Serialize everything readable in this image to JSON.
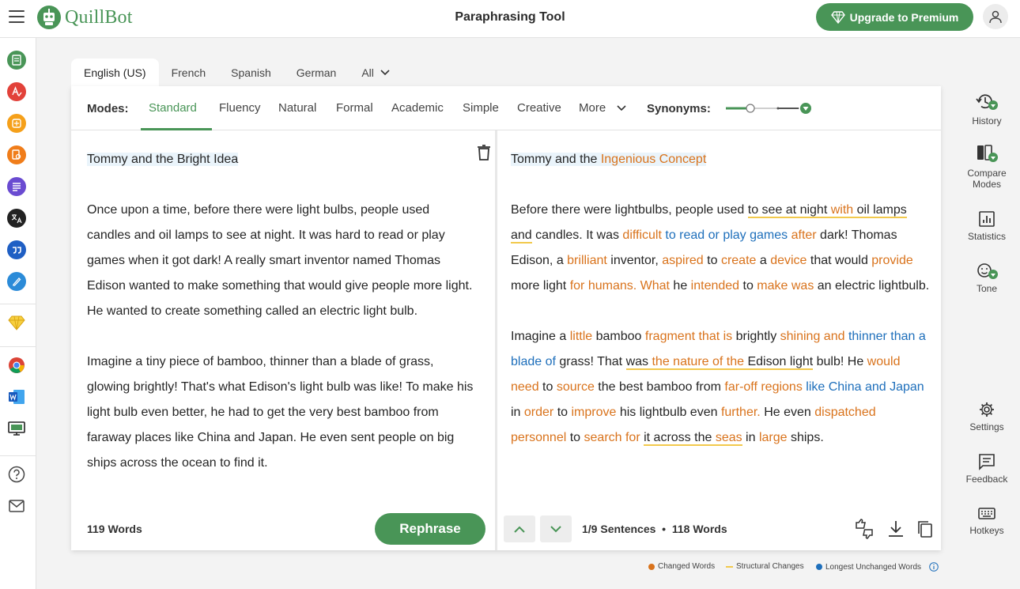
{
  "app": {
    "name": "QuillBot",
    "title": "Paraphrasing Tool"
  },
  "header": {
    "upgrade_label": "Upgrade to Premium"
  },
  "languages": [
    "English (US)",
    "French",
    "Spanish",
    "German",
    "All"
  ],
  "modes": {
    "label": "Modes:",
    "items": [
      "Standard",
      "Fluency",
      "Natural",
      "Formal",
      "Academic",
      "Simple",
      "Creative",
      "More"
    ],
    "active": "Standard",
    "synonyms_label": "Synonyms:",
    "synonyms_level": 0.3
  },
  "input": {
    "title": "Tommy and the Bright Idea",
    "paragraphs": [
      "Once upon a time, before there were light bulbs, people used candles and oil lamps to see at night.  It was hard to read or play games when it got dark! A really smart inventor named Thomas Edison wanted to make something that would give people more light. He wanted to create something called an electric light bulb.",
      "Imagine a tiny piece of bamboo, thinner than a blade of grass, glowing brightly! That's what Edison's light bulb was like!  To make his light bulb even better, he had to get the very best bamboo from faraway places like China and Japan. He even sent people on big ships across the ocean to find it."
    ],
    "word_count": "119 Words",
    "rephrase_label": "Rephrase"
  },
  "output": {
    "title_segments": [
      {
        "t": "Tommy and the ",
        "k": "n"
      },
      {
        "t": "Ingenious Concept",
        "k": "c"
      }
    ],
    "paragraphs": [
      [
        {
          "t": "Before there were lightbulbs, people used ",
          "k": "n"
        },
        {
          "t": "to see at night ",
          "k": "y"
        },
        {
          "t": "with",
          "k": "cy"
        },
        {
          "t": " oil lamps and",
          "k": "y"
        },
        {
          "t": " candles.  It was ",
          "k": "n"
        },
        {
          "t": "difficult",
          "k": "c"
        },
        {
          "t": " ",
          "k": "n"
        },
        {
          "t": "to read or play games",
          "k": "b"
        },
        {
          "t": " ",
          "k": "n"
        },
        {
          "t": "after",
          "k": "c"
        },
        {
          "t": " dark! Thomas Edison, a ",
          "k": "n"
        },
        {
          "t": "brilliant",
          "k": "c"
        },
        {
          "t": " inventor, ",
          "k": "n"
        },
        {
          "t": "aspired",
          "k": "c"
        },
        {
          "t": " to ",
          "k": "n"
        },
        {
          "t": "create",
          "k": "c"
        },
        {
          "t": " a ",
          "k": "n"
        },
        {
          "t": "device",
          "k": "c"
        },
        {
          "t": " that would ",
          "k": "n"
        },
        {
          "t": "provide",
          "k": "c"
        },
        {
          "t": " more light ",
          "k": "n"
        },
        {
          "t": "for humans. What",
          "k": "c"
        },
        {
          "t": " he ",
          "k": "n"
        },
        {
          "t": "intended",
          "k": "c"
        },
        {
          "t": " to ",
          "k": "n"
        },
        {
          "t": "make was",
          "k": "c"
        },
        {
          "t": " an electric lightbulb.",
          "k": "n"
        }
      ],
      [
        {
          "t": "Imagine a ",
          "k": "n"
        },
        {
          "t": "little",
          "k": "c"
        },
        {
          "t": " bamboo ",
          "k": "n"
        },
        {
          "t": "fragment that is",
          "k": "c"
        },
        {
          "t": " brightly ",
          "k": "n"
        },
        {
          "t": "shining and",
          "k": "c"
        },
        {
          "t": " ",
          "k": "n"
        },
        {
          "t": "thinner than a blade of",
          "k": "b"
        },
        {
          "t": " grass! That ",
          "k": "n"
        },
        {
          "t": "was ",
          "k": "y"
        },
        {
          "t": "the nature of the",
          "k": "cy"
        },
        {
          "t": " Edison light",
          "k": "y"
        },
        {
          "t": " bulb!  He ",
          "k": "n"
        },
        {
          "t": "would need",
          "k": "c"
        },
        {
          "t": " to ",
          "k": "n"
        },
        {
          "t": "source",
          "k": "c"
        },
        {
          "t": " the best bamboo from ",
          "k": "n"
        },
        {
          "t": "far-off regions",
          "k": "c"
        },
        {
          "t": " ",
          "k": "n"
        },
        {
          "t": "like China and Japan",
          "k": "b"
        },
        {
          "t": " in ",
          "k": "n"
        },
        {
          "t": "order",
          "k": "c"
        },
        {
          "t": " to ",
          "k": "n"
        },
        {
          "t": "improve",
          "k": "c"
        },
        {
          "t": " his lightbulb even ",
          "k": "n"
        },
        {
          "t": "further.",
          "k": "c"
        },
        {
          "t": " He even ",
          "k": "n"
        },
        {
          "t": "dispatched personnel",
          "k": "c"
        },
        {
          "t": " to ",
          "k": "n"
        },
        {
          "t": "search for",
          "k": "c"
        },
        {
          "t": " ",
          "k": "n"
        },
        {
          "t": "it across the ",
          "k": "y"
        },
        {
          "t": "seas",
          "k": "cy"
        },
        {
          "t": " in ",
          "k": "n"
        },
        {
          "t": "large",
          "k": "c"
        },
        {
          "t": " ships.",
          "k": "n"
        }
      ]
    ],
    "sentence_info": "1/9 Sentences",
    "word_count": "118 Words"
  },
  "right_sidebar": [
    "History",
    "Compare Modes",
    "Statistics",
    "Tone",
    "Settings",
    "Feedback",
    "Hotkeys"
  ],
  "legend": {
    "changed": "Changed Words",
    "structural": "Structural Changes",
    "unchanged": "Longest Unchanged Words"
  },
  "colors": {
    "brand_green": "#499557",
    "changed": "#d9731c",
    "unchanged": "#1e6fbb",
    "structural": "#f2c94c"
  },
  "left_sidebar_icons": [
    "paraphraser-icon",
    "grammar-checker-icon",
    "ai-detector-icon",
    "plagiarism-checker-icon",
    "summarizer-icon",
    "translator-icon",
    "citation-generator-icon",
    "co-writer-icon",
    "premium-diamond-icon",
    "chrome-extension-icon",
    "word-addin-icon",
    "desktop-app-icon",
    "help-icon",
    "mail-icon"
  ]
}
